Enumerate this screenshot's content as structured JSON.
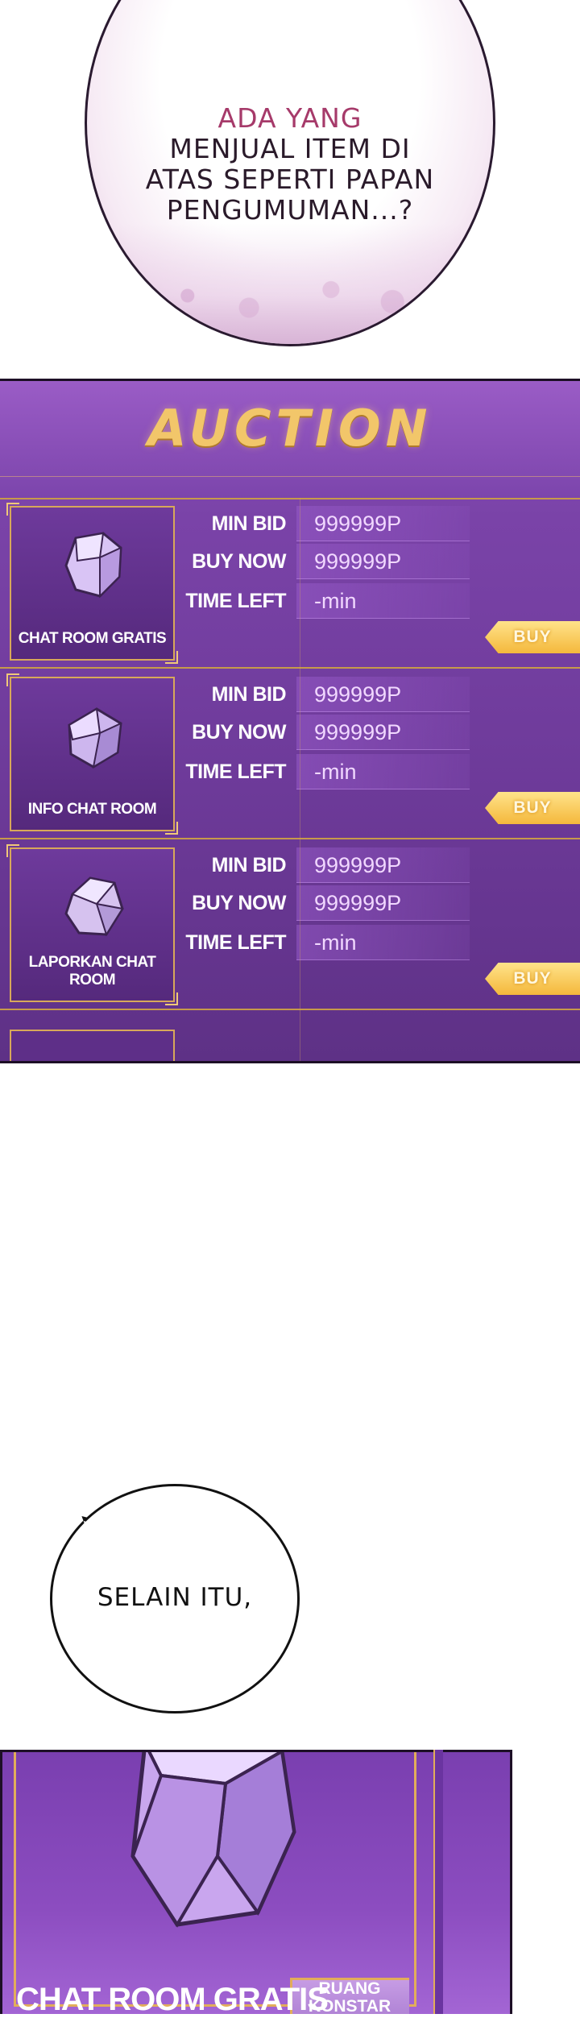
{
  "bubbles": {
    "top": [
      "ADA YANG",
      "MENJUAL ITEM DI",
      "ATAS SEPERTI PAPAN",
      "PENGUMUMAN...?"
    ],
    "middle": "SELAIN ITU,"
  },
  "auction": {
    "title": "AUCTION",
    "labels": {
      "min_bid": "MIN BID",
      "buy_now": "BUY NOW",
      "time_left": "TIME LEFT"
    },
    "items": [
      {
        "name": "CHAT ROOM GRATIS",
        "min_bid": "999999P",
        "buy_now": "999999P",
        "time_left": "-min",
        "button": "BUY"
      },
      {
        "name": "INFO CHAT ROOM",
        "min_bid": "999999P",
        "buy_now": "999999P",
        "time_left": "-min",
        "button": "BUY"
      },
      {
        "name": "LAPORKAN CHAT ROOM",
        "min_bid": "999999P",
        "buy_now": "999999P",
        "time_left": "-min",
        "button": "BUY"
      }
    ]
  },
  "zoom": {
    "label": "CHAT ROOM GRATIS",
    "side_label": "RUANG KONSTAR"
  },
  "colors": {
    "panel_purple": "#7a43a8",
    "gold": "#f2c66a",
    "buy_button": "#f4b83c"
  }
}
